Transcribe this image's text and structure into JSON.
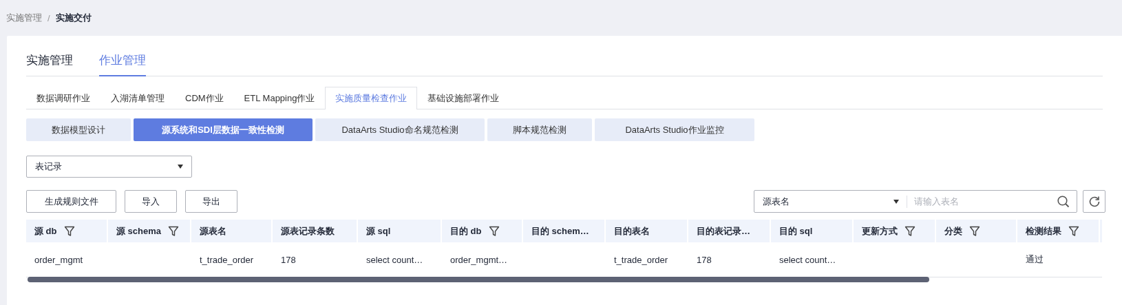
{
  "breadcrumb": [
    {
      "label": "实施管理",
      "current": false
    },
    {
      "label": "实施交付",
      "current": true
    }
  ],
  "breadcrumb_separator": "/",
  "main_tabs": [
    {
      "label": "实施管理",
      "selected": false
    },
    {
      "label": "作业管理",
      "selected": true
    }
  ],
  "sub_tabs": [
    {
      "label": "数据调研作业",
      "selected": false
    },
    {
      "label": "入湖清单管理",
      "selected": false
    },
    {
      "label": "CDM作业",
      "selected": false
    },
    {
      "label": "ETL Mapping作业",
      "selected": false
    },
    {
      "label": "实施质量检查作业",
      "selected": true
    },
    {
      "label": "基础设施部署作业",
      "selected": false
    }
  ],
  "check_tabs": [
    {
      "label": "数据模型设计",
      "selected": false
    },
    {
      "label": "源系统和SDI层数据一致性检测",
      "selected": true
    },
    {
      "label": "DataArts Studio命名规范检测",
      "selected": false
    },
    {
      "label": "脚本规范检测",
      "selected": false
    },
    {
      "label": "DataArts Studio作业监控",
      "selected": false
    }
  ],
  "record_select": {
    "value": "表记录"
  },
  "buttons": [
    "生成规则文件",
    "导入",
    "导出"
  ],
  "search": {
    "field": "源表名",
    "placeholder": "请输入表名"
  },
  "table": {
    "columns": [
      {
        "label": "源 db",
        "filter": true
      },
      {
        "label": "源 schema",
        "filter": true
      },
      {
        "label": "源表名",
        "filter": false
      },
      {
        "label": "源表记录条数",
        "filter": false
      },
      {
        "label": "源 sql",
        "filter": false
      },
      {
        "label": "目的 db",
        "filter": true
      },
      {
        "label": "目的 schem…",
        "filter": false
      },
      {
        "label": "目的表名",
        "filter": false
      },
      {
        "label": "目的表记录…",
        "filter": false
      },
      {
        "label": "目的 sql",
        "filter": false
      },
      {
        "label": "更新方式",
        "filter": true
      },
      {
        "label": "分类",
        "filter": true
      },
      {
        "label": "检测结果",
        "filter": true
      }
    ],
    "rows": [
      [
        "order_mgmt",
        "",
        "t_trade_order",
        "178",
        "select count…",
        "order_mgmt…",
        "",
        "t_trade_order",
        "178",
        "select count…",
        "",
        "",
        "通过"
      ]
    ]
  }
}
